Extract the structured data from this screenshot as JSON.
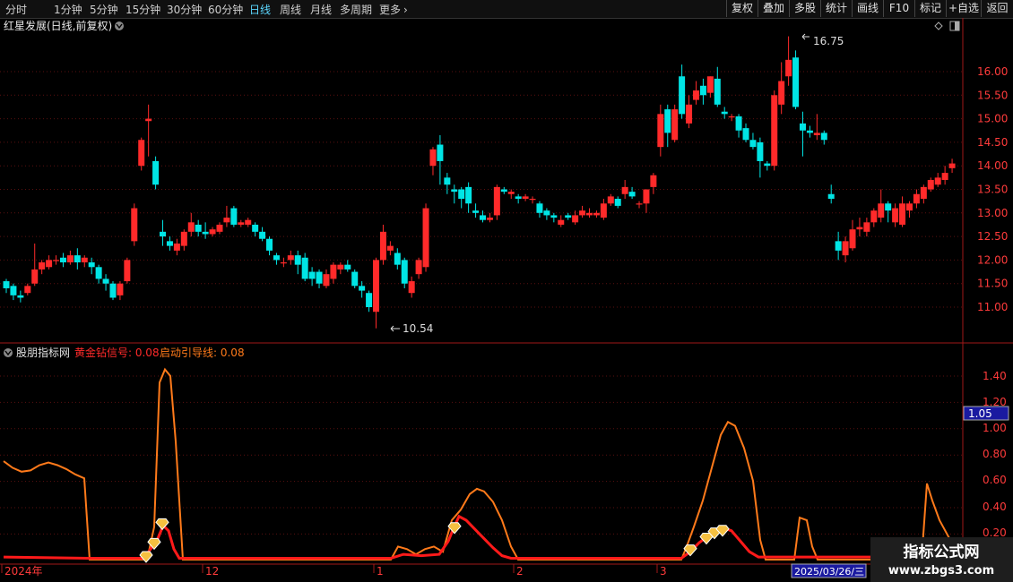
{
  "toolbar": {
    "timeframes": [
      "分时",
      "1分钟",
      "5分钟",
      "15分钟",
      "30分钟",
      "60分钟",
      "日线",
      "周线",
      "月线",
      "多周期",
      "更多"
    ],
    "more_arrow": "›",
    "right_buttons": [
      "复权",
      "叠加",
      "多股",
      "统计",
      "画线",
      "F10",
      "标记",
      "+自选",
      "返回"
    ]
  },
  "main_chart": {
    "stock_title": "红星发展(日线,前复权)",
    "high_label": "16.75",
    "low_label": "10.54",
    "y_ticks": [
      "16.00",
      "15.50",
      "15.00",
      "14.50",
      "14.00",
      "13.50",
      "13.00",
      "12.50",
      "12.00",
      "11.50",
      "11.00"
    ]
  },
  "indicator": {
    "name": "股朋指标网",
    "line1_label": "黄金钻信号: 0.08",
    "line2_label": "启动引导线: 0.08",
    "y_ticks": [
      "1.40",
      "1.20",
      "1.00",
      "0.80",
      "0.60",
      "0.40",
      "0.20"
    ],
    "current_value": "1.05"
  },
  "x_axis": {
    "labels": [
      "2024年",
      "12",
      "1",
      "2",
      "3"
    ],
    "cursor_date": "2025/03/26/三"
  },
  "watermark": {
    "title": "指标公式网",
    "url": "www.zbgs3.com"
  },
  "colors": {
    "up": "#ff2a2a",
    "down": "#00e5e5",
    "line_orange": "#ff7a1a",
    "line_red": "#ff1a1a",
    "active_tab": "#5bd7ff",
    "axis_border": "#a01818"
  },
  "icons": [
    "collapse-arrow-icon",
    "diamond-icon",
    "window-icon",
    "circle-arrow-icon",
    "golden-diamond-marker-icon"
  ]
}
